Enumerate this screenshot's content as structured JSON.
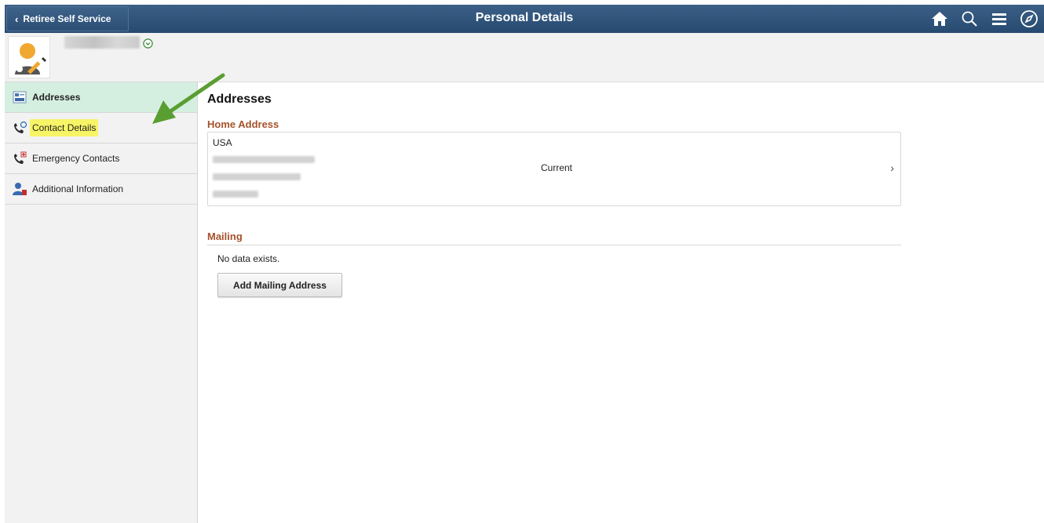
{
  "header": {
    "back_label": "Retiree Self Service",
    "title": "Personal Details",
    "icons": [
      "home-icon",
      "search-icon",
      "menu-icon",
      "navbar-compass-icon"
    ]
  },
  "profile": {
    "avatar_icon": "person-edit-icon",
    "menu_icon": "chevron-down-circle-icon"
  },
  "nav": {
    "items": [
      {
        "label": "Addresses",
        "icon": "address-card-icon",
        "active": true
      },
      {
        "label": "Contact Details",
        "icon": "phone-email-icon",
        "highlighted": true
      },
      {
        "label": "Emergency Contacts",
        "icon": "phone-emergency-icon"
      },
      {
        "label": "Additional Information",
        "icon": "person-info-icon"
      }
    ]
  },
  "main": {
    "title": "Addresses",
    "home_address": {
      "heading": "Home Address",
      "country": "USA",
      "status": "Current"
    },
    "mailing": {
      "heading": "Mailing",
      "empty_text": "No data exists.",
      "add_button": "Add Mailing Address"
    }
  },
  "colors": {
    "header_bg": "#264a70",
    "section_heading": "#a5522a",
    "active_nav_bg": "#d4efe0",
    "highlight": "#f7f466",
    "annotation_arrow": "#5a9e32"
  }
}
